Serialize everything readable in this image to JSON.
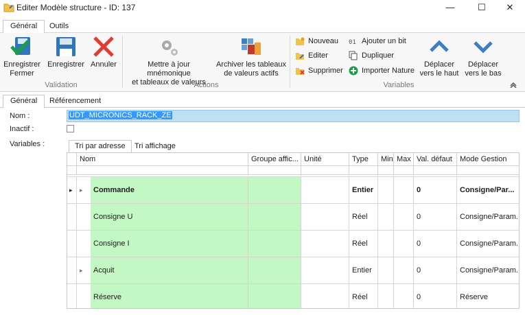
{
  "window": {
    "title": "Editer Modèle structure - ID: 137",
    "minimize": "—",
    "maximize": "☐",
    "close": "✕"
  },
  "ribbon": {
    "tabs": [
      "Général",
      "Outils"
    ],
    "validation": {
      "caption": "Validation",
      "save_close_line1": "Enregistrer",
      "save_close_line2": "Fermer",
      "save": "Enregistrer",
      "cancel": "Annuler"
    },
    "actions": {
      "caption": "Actions",
      "update_line1": "Mettre à jour mnémonique",
      "update_line2": "et tableaux de valeurs",
      "archive_line1": "Archiver les tableaux",
      "archive_line2": "de valeurs actifs"
    },
    "variables": {
      "caption": "Variables",
      "nouveau": "Nouveau",
      "editer": "Editer",
      "supprimer": "Supprimer",
      "ajouter_bit": "Ajouter un bit",
      "dupliquer": "Dupliquer",
      "importer_nature": "Importer Nature",
      "move_up_line1": "Déplacer",
      "move_up_line2": "vers le haut",
      "move_down_line1": "Déplacer",
      "move_down_line2": "vers le bas"
    }
  },
  "form": {
    "tabs": [
      "Général",
      "Référencement"
    ],
    "nom_label": "Nom :",
    "nom_value": "UDT_MICRONICS_RACK_ZE",
    "inactif_label": "Inactif :",
    "inactif_checked": false,
    "variables_label": "Variables :",
    "var_tabs": [
      "Tri par adresse",
      "Tri affichage"
    ]
  },
  "grid": {
    "columns": [
      "Nom",
      "Groupe affic...",
      "Unité",
      "Type",
      "Min",
      "Max",
      "Val. défaut",
      "Mode Gestion"
    ],
    "rows": [
      {
        "nom": "Commande",
        "groupe": "",
        "unite": "",
        "type": "Entier",
        "min": "",
        "max": "",
        "defaut": "0",
        "mode": "Consigne/Par...",
        "expander": "▸",
        "current": true,
        "bold": true
      },
      {
        "nom": "Consigne U",
        "groupe": "",
        "unite": "",
        "type": "Réel",
        "min": "",
        "max": "",
        "defaut": "0",
        "mode": "Consigne/Param...",
        "expander": "",
        "current": false,
        "bold": false
      },
      {
        "nom": "Consigne I",
        "groupe": "",
        "unite": "",
        "type": "Réel",
        "min": "",
        "max": "",
        "defaut": "0",
        "mode": "Consigne/Param...",
        "expander": "",
        "current": false,
        "bold": false
      },
      {
        "nom": "Acquit",
        "groupe": "",
        "unite": "",
        "type": "Entier",
        "min": "",
        "max": "",
        "defaut": "0",
        "mode": "Consigne/Param...",
        "expander": "▸",
        "current": false,
        "bold": false
      },
      {
        "nom": "Réserve",
        "groupe": "",
        "unite": "",
        "type": "Réel",
        "min": "",
        "max": "",
        "defaut": "0",
        "mode": "Réserve",
        "expander": "",
        "current": false,
        "bold": false
      }
    ],
    "current_row_marker": "▸"
  },
  "colors": {
    "accent_green": "#c3f7c3",
    "selection": "#3399ff",
    "save_icon": "#2f77b8",
    "cancel_icon": "#e03c31",
    "arrow_icon": "#3d7fc1"
  }
}
